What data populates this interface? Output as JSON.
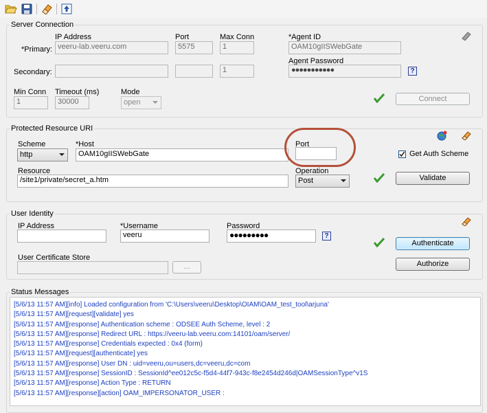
{
  "toolbar": {
    "items": [
      "open-folder-icon",
      "save-icon",
      "eraser-icon",
      "upload-icon"
    ]
  },
  "server_connection": {
    "title": "Server Connection",
    "ip_address_label": "IP Address",
    "port_label": "Port",
    "max_conn_label": "Max Conn",
    "agent_id_label": "*Agent ID",
    "primary_label": "*Primary:",
    "secondary_label": "Secondary:",
    "primary_ip": "veeru-lab.veeru.com",
    "primary_port": "5575",
    "primary_max_conn": "1",
    "agent_id": "OAM10gIISWebGate",
    "secondary_ip": "",
    "secondary_port": "",
    "secondary_max_conn": "1",
    "agent_password_label": "Agent Password",
    "agent_password": "●●●●●●●●●●●",
    "help_label": "?",
    "min_conn_label": "Min Conn",
    "timeout_label": "Timeout (ms)",
    "mode_label": "Mode",
    "min_conn": "1",
    "timeout": "30000",
    "mode": "open",
    "connect_label": "Connect"
  },
  "protected_resource": {
    "title": "Protected Resource URI",
    "scheme_label": "Scheme",
    "scheme": "http",
    "host_label": "*Host",
    "host": "OAM10gIISWebGate",
    "port_label": "Port",
    "port": "",
    "get_auth_scheme_label": "Get Auth Scheme",
    "get_auth_scheme_checked": true,
    "resource_label": "Resource",
    "resource": "/site1/private/secret_a.htm",
    "operation_label": "Operation",
    "operation": "Post",
    "validate_label": "Validate",
    "highlight_color": "#b5503a"
  },
  "user_identity": {
    "title": "User Identity",
    "ip_address_label": "IP Address",
    "ip_address": "",
    "username_label": "*Username",
    "username": "veeru",
    "password_label": "Password",
    "password": "●●●●●●●●●",
    "help_label": "?",
    "authenticate_label": "Authenticate",
    "cert_store_label": "User Certificate Store",
    "cert_store": "",
    "browse_label": "...",
    "authorize_label": "Authorize"
  },
  "status": {
    "title": "Status Messages",
    "text_color": "#1c3fc0",
    "lines": [
      "[5/6/13 11:57 AM][info] Loaded configuration from 'C:\\Users\\veeru\\Desktop\\OIAM\\OAM_test_tool\\arjuna'",
      "[5/6/13 11:57 AM][request][validate] yes",
      "[5/6/13 11:57 AM][response] Authentication scheme : ODSEE Auth Scheme, level : 2",
      "[5/6/13 11:57 AM][response] Redirect URL : https://veeru-lab.veeru.com:14101/oam/server/",
      "[5/6/13 11:57 AM][response] Credentials expected : 0x4 (form)",
      "[5/6/13 11:57 AM][request][authenticate] yes",
      "[5/6/13 11:57 AM][response] User DN : uid=veeru,ou=users,dc=veeru,dc=com",
      "[5/6/13 11:57 AM][response] SessionID : SessionId^ee012c5c-f5d4-44f7-943c-f8e2454d246d|OAMSessionType^v1S",
      "[5/6/13 11:57 AM][response] Action Type : RETURN",
      "[5/6/13 11:57 AM][response][action] OAM_IMPERSONATOR_USER :"
    ]
  }
}
